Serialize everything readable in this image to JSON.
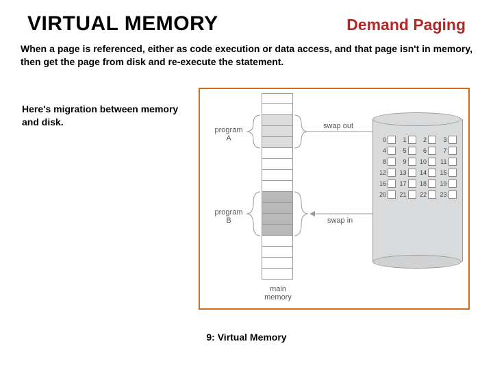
{
  "header": {
    "title": "VIRTUAL MEMORY",
    "subtitle": "Demand Paging"
  },
  "description": "When a page is referenced, either as code execution or data access, and that page isn't in memory, then get the page from disk and re-execute the statement.",
  "caption": "Here's  migration between memory and disk.",
  "footer": "9: Virtual Memory",
  "diagram": {
    "mem_label": "main\nmemory",
    "prog_a": "program\nA",
    "prog_b": "program\nB",
    "swap_out": "swap out",
    "swap_in": "swap in",
    "disk_slots": [
      "0",
      "1",
      "2",
      "3",
      "4",
      "5",
      "6",
      "7",
      "8",
      "9",
      "10",
      "11",
      "12",
      "13",
      "14",
      "15",
      "16",
      "17",
      "18",
      "19",
      "20",
      "21",
      "22",
      "23"
    ]
  }
}
